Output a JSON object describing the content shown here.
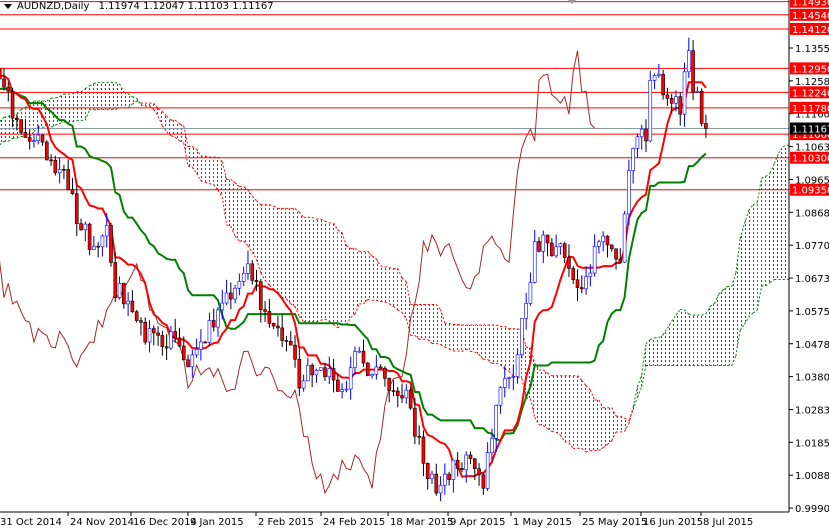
{
  "header": {
    "symbol": "AUDNZD,Daily",
    "open": "1.11974",
    "high": "1.12047",
    "low": "1.11103",
    "close": "1.11167"
  },
  "chart_data": {
    "type": "candlestick",
    "title": "AUDNZD,Daily",
    "indicator": "Ichimoku Kinko Hyo (9,26,52)",
    "ylim": [
      0.99905,
      1.1493
    ],
    "y_ticks": [
      "1.13555",
      "1.12580",
      "1.11605",
      "1.10630",
      "1.09655",
      "1.08680",
      "1.07705",
      "1.06730",
      "1.05755",
      "1.04780",
      "1.03805",
      "1.02830",
      "1.01855",
      "1.00880",
      "0.99905"
    ],
    "x_ticks": [
      "31 Oct 2014",
      "24 Nov 2014",
      "16 Dec 2014",
      "9 Jan 2015",
      "2 Feb 2015",
      "24 Feb 2015",
      "18 Mar 2015",
      "9 Apr 2015",
      "1 May 2015",
      "25 May 2015",
      "16 Jun 2015",
      "8 Jul 2015"
    ],
    "levels": [
      "1.14930",
      "1.14540",
      "1.14120",
      "1.12950",
      "1.12240",
      "1.11780",
      "1.11000",
      "1.10300",
      "1.09350"
    ],
    "current_price": "1.11167",
    "colors": {
      "bull": "#0000ff",
      "bear": "#ff0000",
      "tenkan": "#ff0000",
      "kijun": "#008000",
      "chikou": "#a52a2a",
      "cloud_up": "#008000",
      "cloud_down": "#ff0000",
      "level": "#ff0000"
    },
    "close_waypoints": [
      [
        -80,
        1.095
      ],
      [
        -60,
        1.102
      ],
      [
        -45,
        1.112
      ],
      [
        -30,
        1.118
      ],
      [
        -15,
        1.124
      ],
      [
        -5,
        1.128
      ],
      [
        0,
        1.1261
      ],
      [
        2,
        1.1142
      ],
      [
        4,
        1.1127
      ],
      [
        8,
        1.1083
      ],
      [
        11,
        1.0994
      ],
      [
        15,
        1.0964
      ],
      [
        17,
        1.0845
      ],
      [
        20,
        1.0786
      ],
      [
        24,
        1.0801
      ],
      [
        26,
        1.0637
      ],
      [
        29,
        1.0608
      ],
      [
        32,
        1.0519
      ],
      [
        36,
        1.0474
      ],
      [
        39,
        1.0489
      ],
      [
        43,
        1.04
      ],
      [
        45,
        1.0474
      ],
      [
        48,
        1.0519
      ],
      [
        52,
        1.0608
      ],
      [
        55,
        1.0667
      ],
      [
        57,
        1.0727
      ],
      [
        60,
        1.0608
      ],
      [
        63,
        1.0548
      ],
      [
        67,
        1.046
      ],
      [
        69,
        1.0371
      ],
      [
        73,
        1.04
      ],
      [
        76,
        1.0385
      ],
      [
        80,
        1.0326
      ],
      [
        82,
        1.0445
      ],
      [
        86,
        1.04
      ],
      [
        89,
        1.04
      ],
      [
        91,
        1.0311
      ],
      [
        94,
        1.0326
      ],
      [
        96,
        1.0222
      ],
      [
        98,
        1.0133
      ],
      [
        101,
        1.0044
      ],
      [
        103,
        1.0103
      ],
      [
        107,
        1.0103
      ],
      [
        109,
        1.0163
      ],
      [
        112,
        1.0059
      ],
      [
        115,
        1.0281
      ],
      [
        117,
        1.0371
      ],
      [
        119,
        1.04
      ],
      [
        122,
        1.0608
      ],
      [
        124,
        1.0756
      ],
      [
        126,
        1.0786
      ],
      [
        129,
        1.0756
      ],
      [
        131,
        1.0756
      ],
      [
        134,
        1.0637
      ],
      [
        137,
        1.0697
      ],
      [
        139,
        1.0786
      ],
      [
        141,
        1.0756
      ],
      [
        144,
        1.0727
      ],
      [
        146,
        1.0964
      ],
      [
        147,
        1.1083
      ],
      [
        150,
        1.1097
      ],
      [
        151,
        1.1231
      ],
      [
        153,
        1.1261
      ],
      [
        155,
        1.1201
      ],
      [
        158,
        1.1172
      ],
      [
        160,
        1.1365
      ],
      [
        161,
        1.1216
      ],
      [
        162,
        1.1201
      ],
      [
        164,
        1.1117
      ]
    ]
  }
}
